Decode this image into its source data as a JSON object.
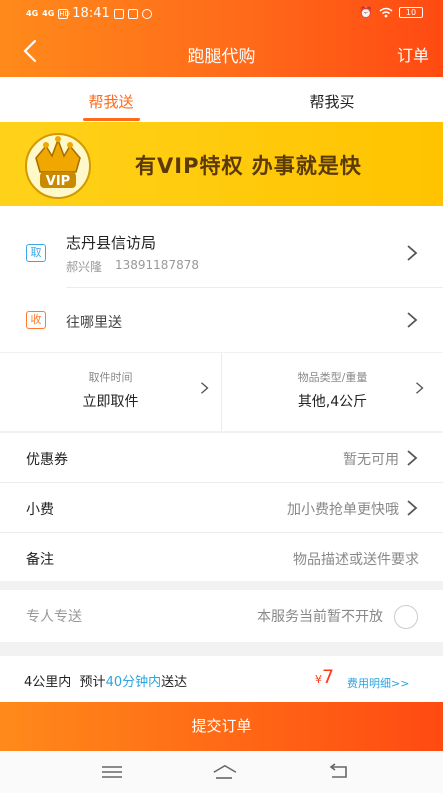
{
  "status_bar": {
    "network_1": "4G",
    "network_2": "4G",
    "hd": "HD",
    "time": "18:41",
    "battery": "10"
  },
  "nav": {
    "title": "跑腿代购",
    "right": "订单"
  },
  "tabs": [
    {
      "label": "帮我送",
      "active": true
    },
    {
      "label": "帮我买",
      "active": false
    }
  ],
  "banner": {
    "vip_label": "VIP",
    "slogan": "有VIP特权  办事就是快"
  },
  "pickup": {
    "tag": "取",
    "name": "志丹县信访局",
    "contact": "郝兴隆",
    "phone": "13891187878"
  },
  "delivery": {
    "tag": "收",
    "placeholder": "往哪里送"
  },
  "pickup_time": {
    "label": "取件时间",
    "value": "立即取件"
  },
  "item_type": {
    "label": "物品类型/重量",
    "value": "其他,4公斤"
  },
  "options": [
    {
      "label": "优惠券",
      "value": "暂无可用"
    },
    {
      "label": "小费",
      "value": "加小费抢单更快哦"
    },
    {
      "label": "备注",
      "value": "物品描述或送件要求"
    }
  ],
  "dedicated": {
    "label": "专人专送",
    "value": "本服务当前暂不开放"
  },
  "summary": {
    "distance": "4公里内",
    "estimate_prefix": "预计",
    "estimate_time": "40分钟内",
    "estimate_suffix": "送达",
    "currency": "¥",
    "price": "7",
    "fee_link": "费用明细>>"
  },
  "submit_label": "提交订单",
  "colors": {
    "accent": "#ff6a1a",
    "link": "#2aa6df",
    "price": "#ff3b1a",
    "banner": "#ffc300"
  }
}
